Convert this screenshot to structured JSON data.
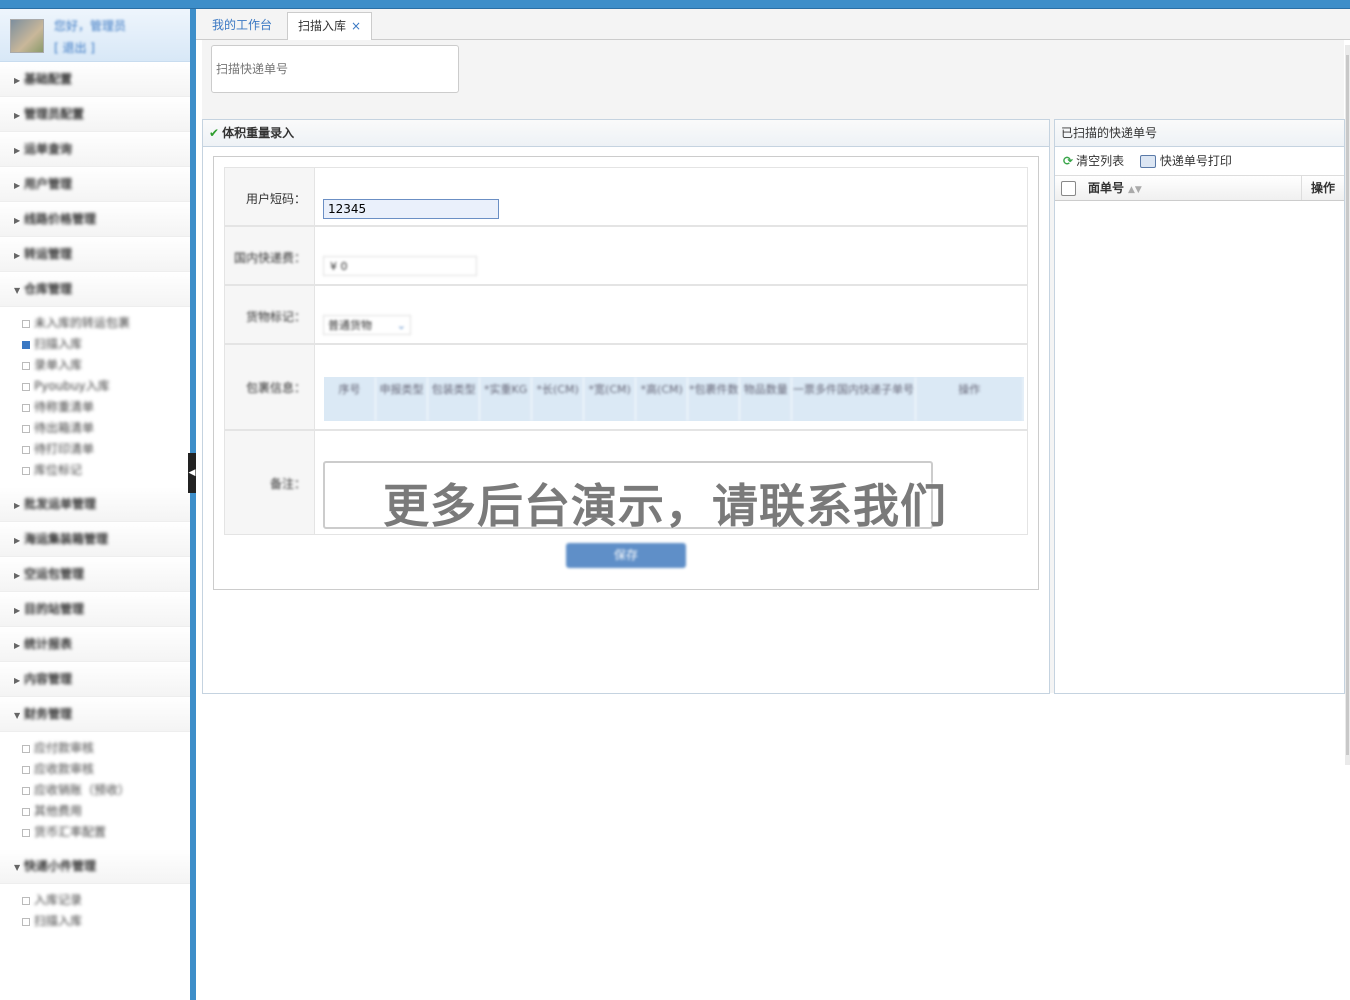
{
  "sidebar": {
    "user": {
      "greeting": "您好，管理员",
      "logout": "[ 退出 ]"
    },
    "groups": [
      {
        "label": "基础配置",
        "expanded": false
      },
      {
        "label": "管理员配置",
        "expanded": false
      },
      {
        "label": "运单查询",
        "expanded": false
      },
      {
        "label": "用户管理",
        "expanded": false
      },
      {
        "label": "线路价格管理",
        "expanded": false
      },
      {
        "label": "转运管理",
        "expanded": false
      },
      {
        "label": "仓库管理",
        "expanded": true,
        "items": [
          "未入库的转运包裹",
          "扫描入库",
          "录单入库",
          "Pyoubuy入库",
          "待称重清单",
          "待出箱清单",
          "待打印清单",
          "库位标记"
        ]
      },
      {
        "label": "批发运单管理",
        "expanded": false
      },
      {
        "label": "海运集装箱管理",
        "expanded": false
      },
      {
        "label": "空运包管理",
        "expanded": false
      },
      {
        "label": "目的站管理",
        "expanded": false
      },
      {
        "label": "统计报表",
        "expanded": false
      },
      {
        "label": "内容管理",
        "expanded": false
      },
      {
        "label": "财务管理",
        "expanded": true,
        "items": [
          "应付款审核",
          "应收款审核",
          "应收销账（预收）",
          "其他费用",
          "货币汇率配置"
        ]
      },
      {
        "label": "快递小件管理",
        "expanded": true,
        "items": [
          "入库记录",
          "扫描入库"
        ]
      }
    ]
  },
  "tabs": [
    {
      "label": "我的工作台",
      "active": false
    },
    {
      "label": "扫描入库",
      "active": true,
      "close": "×"
    }
  ],
  "scan": {
    "placeholder": "扫描快递单号"
  },
  "form": {
    "title": "体积重量录入",
    "user_code_label": "用户短码：",
    "user_code_value": "12345",
    "domestic_fee_label": "国内快递费：",
    "domestic_fee_value": "¥ 0",
    "cargo_label": "货物标记：",
    "cargo_value": "普通货物",
    "package_label": "包裹信息：",
    "package_columns": [
      "序号",
      "申报类型",
      "包装类型",
      "*实重KG",
      "*长(CM)",
      "*宽(CM)",
      "*高(CM)",
      "*包裹件数",
      "物品数量",
      "一票多件国内快递子单号",
      "操作"
    ],
    "note_label": "备注：",
    "save_label": "保存"
  },
  "watermark": "更多后台演示，请联系我们",
  "scanned": {
    "title": "已扫描的快递单号",
    "clear_label": "清空列表",
    "print_label": "快递单号打印",
    "col_no": "面单号",
    "col_op": "操作"
  },
  "colors": {
    "accent": "#3d8ec9",
    "link": "#3a78c3"
  }
}
